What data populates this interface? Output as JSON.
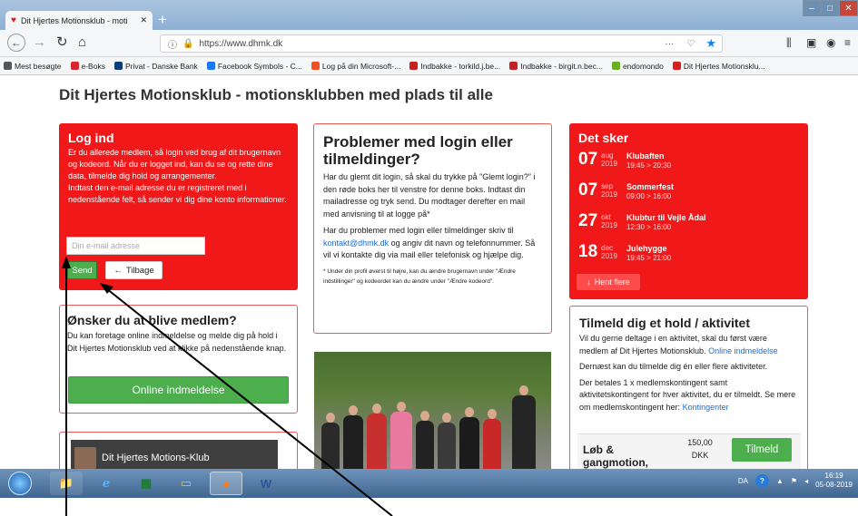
{
  "browser": {
    "tab_title": "Dit Hjertes Motionsklub - moti",
    "tab_close": "✕",
    "new_tab": "+",
    "url": "https://www.dhmk.dk",
    "url_info": "ⓘ",
    "url_menu": "···",
    "bookmarks": [
      {
        "label": "Mest besøgte",
        "color": "#555555"
      },
      {
        "label": "e-Boks",
        "color": "#d9262c"
      },
      {
        "label": "Privat - Danske Bank",
        "color": "#0a3d7a"
      },
      {
        "label": "Facebook Symbols - C...",
        "color": "#1877f2"
      },
      {
        "label": "Log på din Microsoft-...",
        "color": "#f25022"
      },
      {
        "label": "Indbakke - torkild.j.be...",
        "color": "#c5221f"
      },
      {
        "label": "Indbakke - birgit.n.bec...",
        "color": "#c5221f"
      },
      {
        "label": "endomondo",
        "color": "#6ab023"
      },
      {
        "label": "Dit Hjertes Motionsklu...",
        "color": "#d81e1e"
      }
    ]
  },
  "site_title": "Dit Hjertes Motionsklub - motionsklubben med plads til alle",
  "login": {
    "title": "Log ind",
    "text": "Er du allerede medlem, så login ved brug af dit brugernavn og kodeord. Når du er logget ind, kan du se og rette dine data, tilmelde dig hold og arrangementer.\nIndtast den e-mail adresse du er registreret med i nedenstående felt, så sender vi dig dine konto informationer.",
    "email_placeholder": "Din e-mail adresse",
    "send_label": "Send",
    "back_label": "Tilbage",
    "back_icon": "←"
  },
  "problems": {
    "title": "Problemer med login eller tilmeldinger?",
    "p1": "Har du glemt dit login, så skal du trykke på \"Glemt login?\" i den røde boks her til venstre for denne boks. Indtast din mailadresse og tryk send. Du modtager derefter en mail med anvisning til at logge på*",
    "p2_before": "Har du problemer med login eller tilmeldinger skriv til ",
    "p2_link": "kontakt@dhmk.dk",
    "p2_after": " og angiv dit navn og telefonnummer. Så vil vi kontakte dig via mail eller telefonisk og hjælpe dig.",
    "note": "* Under din profil øverst til højre, kan du ændre brugernavn under \"Ændre indstillinger\" og kodeordet kan du ændre under \"Ændre kodeord\"."
  },
  "member": {
    "title": "Ønsker du at blive medlem?",
    "text": "Du kan foretage online indmeldelse og melde dig på hold i Dit Hjertes Motionsklub ved at klikke på nedenstående knap.",
    "button": "Online indmeldelse"
  },
  "video": {
    "title": "Dit Hjertes Motions-Klub"
  },
  "events": {
    "title": "Det sker",
    "items": [
      {
        "day": "07",
        "month": "aug",
        "year": "2019",
        "name": "Klubaften",
        "time": "19:45 > 20:30"
      },
      {
        "day": "07",
        "month": "sep",
        "year": "2019",
        "name": "Sommerfest",
        "time": "09:00 > 16:00"
      },
      {
        "day": "27",
        "month": "okt",
        "year": "2019",
        "name": "Klubtur til Vejle Ådal",
        "time": "12:30 > 16:00"
      },
      {
        "day": "18",
        "month": "dec",
        "year": "2019",
        "name": "Julehygge",
        "time": "19:45 > 21:00"
      }
    ],
    "more_icon": "↓",
    "more": "Hent flere"
  },
  "activity": {
    "title": "Tilmeld dig et hold / aktivitet",
    "p1": "Vil du gerne deltage i en aktivitet, skal du først være medlem af Dit Hjertes Motionsklub.",
    "p1_link": "Online indmeldelse",
    "p2": "Dernæst kan du tilmelde dig én eller flere aktiviteter.",
    "p3": "Der betales 1 x medlemskontingent samt aktivitetskontingent for hver aktivitet, du er tilmeldt. Se mere om medlemskontingent her:",
    "p3_link": "Kontingenter",
    "item_name": "Løb & gangmotion,",
    "item_price": "150,00",
    "item_currency": "DKK",
    "item_button": "Tilmeld"
  },
  "taskbar": {
    "lang": "DA",
    "time": "16:19",
    "date": "05-08-2019"
  }
}
